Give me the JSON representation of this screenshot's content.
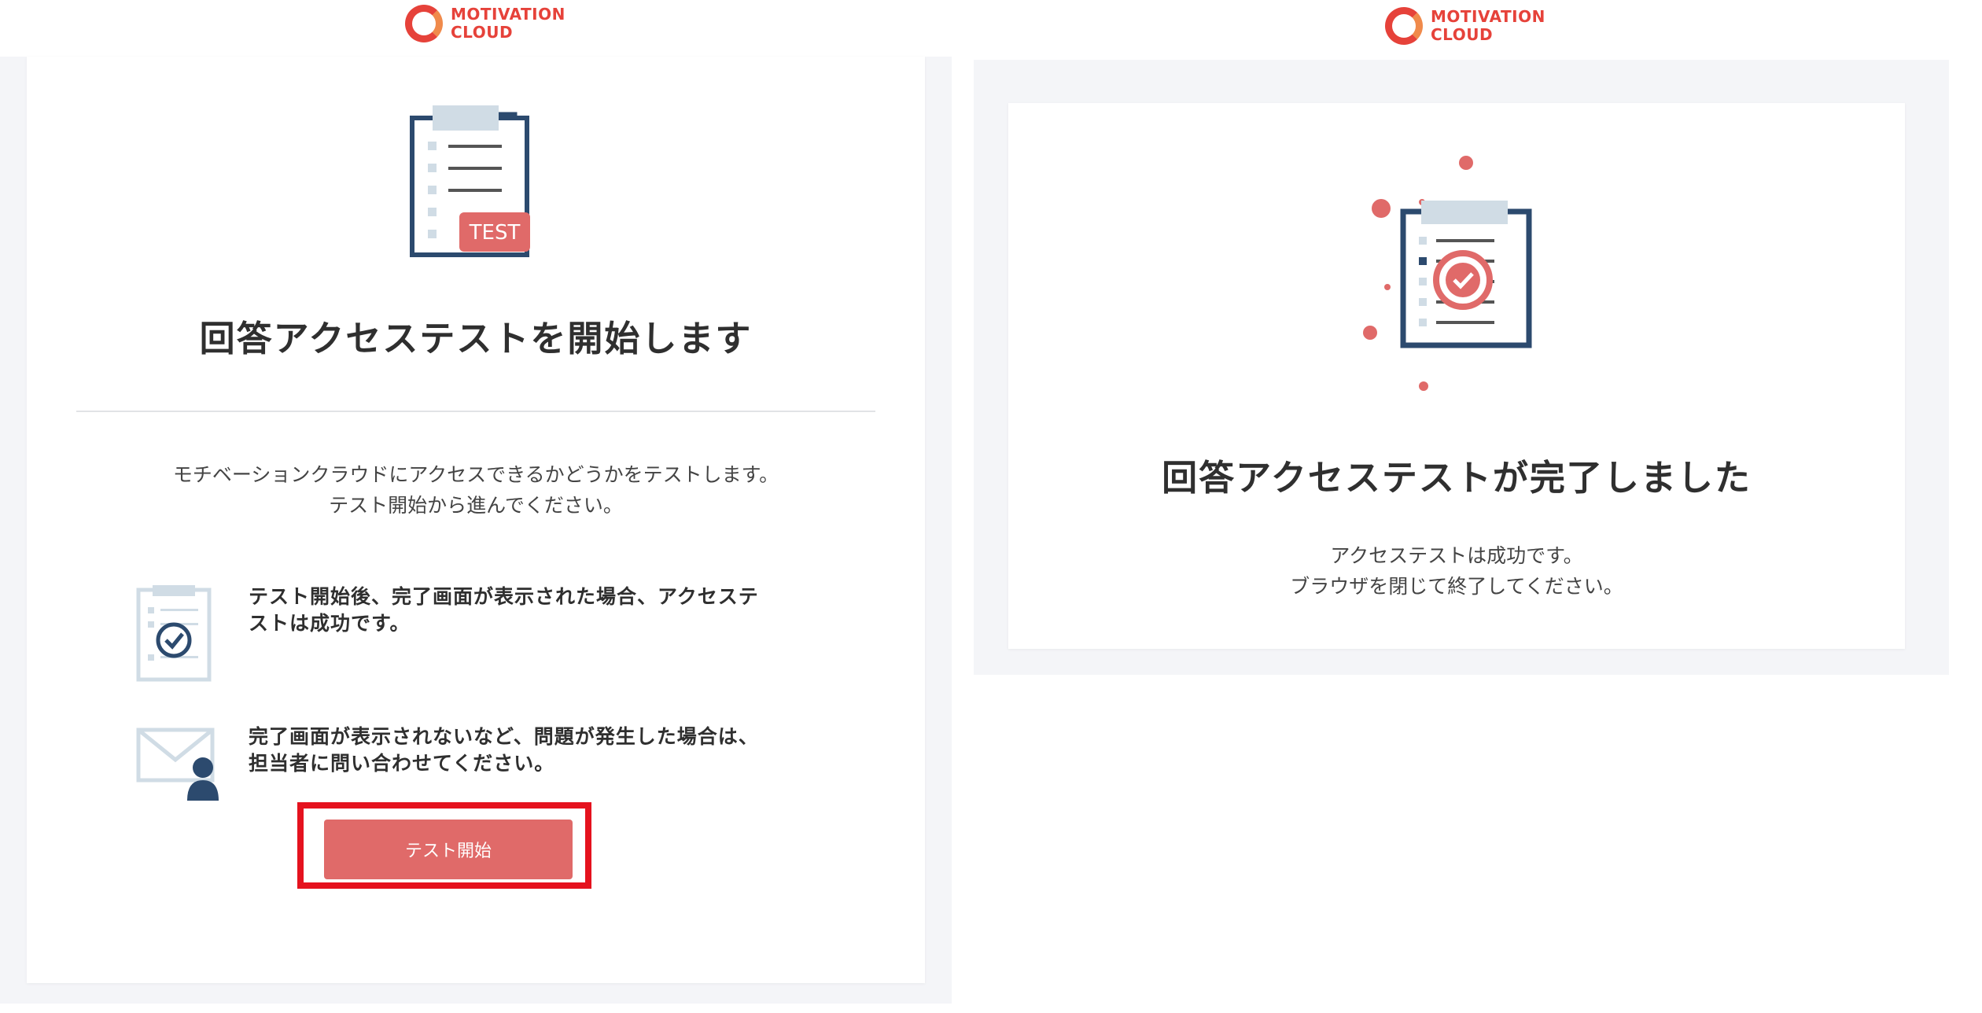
{
  "brand": {
    "line1": "MOTIVATION",
    "line2": "CLOUD",
    "red": "#e6423a",
    "orange": "#f08a4b"
  },
  "colors": {
    "accent": "#e06a69",
    "navy": "#2c4a6e",
    "light_blue": "#d0dce5",
    "highlight": "#e5121e"
  },
  "start_screen": {
    "title": "回答アクセステストを開始します",
    "illustration_badge": "TEST",
    "description": [
      "モチベーションクラウドにアクセスできるかどうかをテストします。",
      "テスト開始から進んでください。"
    ],
    "info_items": [
      {
        "icon": "clipboard-check-icon",
        "lines": [
          "テスト開始後、完了画面が表示された場合、アクセステ",
          "ストは成功です。"
        ]
      },
      {
        "icon": "mail-person-icon",
        "lines": [
          "完了画面が表示されないなど、問題が発生した場合は、",
          "担当者に問い合わせてください。"
        ]
      }
    ],
    "start_button": "テスト開始"
  },
  "complete_screen": {
    "title": "回答アクセステストが完了しました",
    "illustration": "clipboard-success-icon",
    "description": [
      "アクセステストは成功です。",
      "ブラウザを閉じて終了してください。"
    ]
  }
}
